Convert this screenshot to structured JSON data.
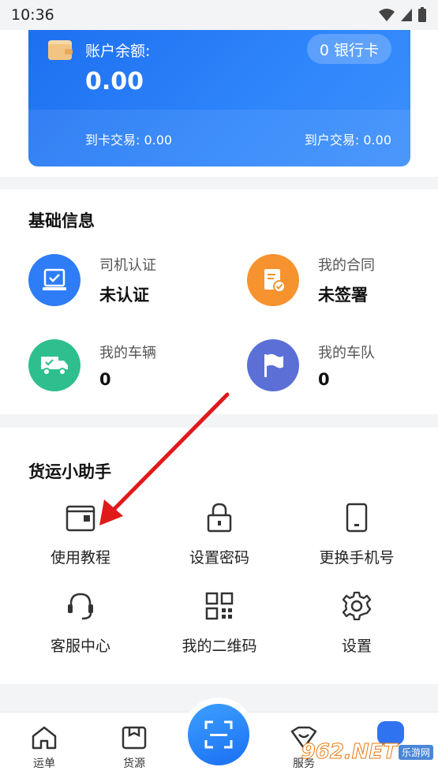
{
  "status_bar": {
    "time": "10:36"
  },
  "balance": {
    "label": "账户余额:",
    "value": "0.00",
    "bank_cards": "0 银行卡",
    "card_transactions": "到卡交易: 0.00",
    "account_transactions": "到户交易: 0.00"
  },
  "basic_info": {
    "title": "基础信息",
    "items": [
      {
        "label": "司机认证",
        "value": "未认证",
        "icon": "driver-cert-icon",
        "color": "#2e7cf6"
      },
      {
        "label": "我的合同",
        "value": "未签署",
        "icon": "contract-icon",
        "color": "#f7932e"
      },
      {
        "label": "我的车辆",
        "value": "0",
        "icon": "truck-icon",
        "color": "#2fbf8f"
      },
      {
        "label": "我的车队",
        "value": "0",
        "icon": "flag-icon",
        "color": "#5b6fd6"
      }
    ]
  },
  "helper": {
    "title": "货运小助手",
    "items": [
      {
        "label": "使用教程",
        "icon": "wallet-icon"
      },
      {
        "label": "设置密码",
        "icon": "lock-icon"
      },
      {
        "label": "更换手机号",
        "icon": "phone-icon"
      },
      {
        "label": "客服中心",
        "icon": "headset-icon"
      },
      {
        "label": "我的二维码",
        "icon": "qr-code-icon"
      },
      {
        "label": "设置",
        "icon": "gear-icon"
      }
    ]
  },
  "bottom_nav": {
    "items": [
      {
        "label": "运单",
        "icon": "home-icon"
      },
      {
        "label": "货源",
        "icon": "box-icon"
      },
      {
        "label": "服务",
        "icon": "service-icon"
      }
    ],
    "scan_icon": "scan-icon"
  },
  "watermark": {
    "number": "962.NET",
    "site": "乐游网"
  },
  "colors": {
    "primary": "#2e7cf6",
    "annotation_arrow": "#e0191b"
  }
}
